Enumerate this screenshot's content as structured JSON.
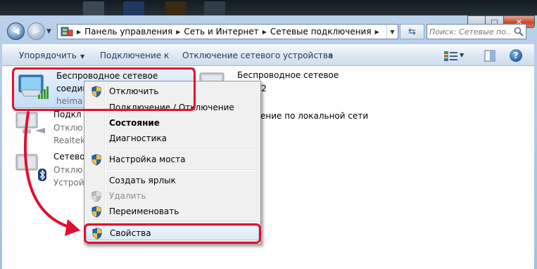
{
  "window": {
    "caption_buttons": {
      "minimize": "▁",
      "maximize": "□",
      "close": "✕"
    }
  },
  "navigation": {
    "back_icon": "back-arrow-icon",
    "forward_icon": "forward-arrow-icon",
    "breadcrumbs": [
      "Панель управления",
      "Сеть и Интернет",
      "Сетевые подключения"
    ],
    "search_placeholder": "Поиск: Сетевые по..."
  },
  "toolbar": {
    "organize": "Упорядочить",
    "connect_to": "Подключение к",
    "disable_device": "Отключение сетевого устройства",
    "more": "»"
  },
  "connections": [
    {
      "name": "Беспроводное сетевое",
      "line2": "соедине",
      "line3": "heima",
      "type": "wireless",
      "selected": true
    },
    {
      "name": "Беспроводное сетевое",
      "line2": "ение 2",
      "type": "wireless",
      "selected": false
    },
    {
      "name": "Подкл",
      "line2": "Отклю",
      "line3": "Realtek",
      "type": "wired",
      "selected": false
    },
    {
      "name": "ение по локальной сети",
      "line2": "",
      "type": "wired",
      "selected": false
    },
    {
      "name": "Сетевое",
      "line2": "Отклю",
      "line3": "Устрой",
      "type": "bluetooth",
      "selected": false
    }
  ],
  "context_menu": {
    "items": [
      {
        "label": "Отключить",
        "shield": true
      },
      {
        "label": "Подключение / Отключение",
        "shield": false
      },
      {
        "label": "Состояние",
        "shield": false,
        "bold": true
      },
      {
        "label": "Диагностика",
        "shield": false
      },
      {
        "label": "Настройка моста",
        "shield": true
      },
      {
        "label": "Создать ярлык",
        "shield": false
      },
      {
        "label": "Удалить",
        "shield": true,
        "disabled": true
      },
      {
        "label": "Переименовать",
        "shield": true
      },
      {
        "label": "Свойства",
        "shield": true,
        "highlighted": true
      }
    ]
  },
  "colors": {
    "annotation_red": "#e0102e",
    "selection_blue": "#c4def8",
    "link_text": "#1e395b",
    "shield_blue": "#2a63b5",
    "shield_yellow": "#f1c232"
  }
}
